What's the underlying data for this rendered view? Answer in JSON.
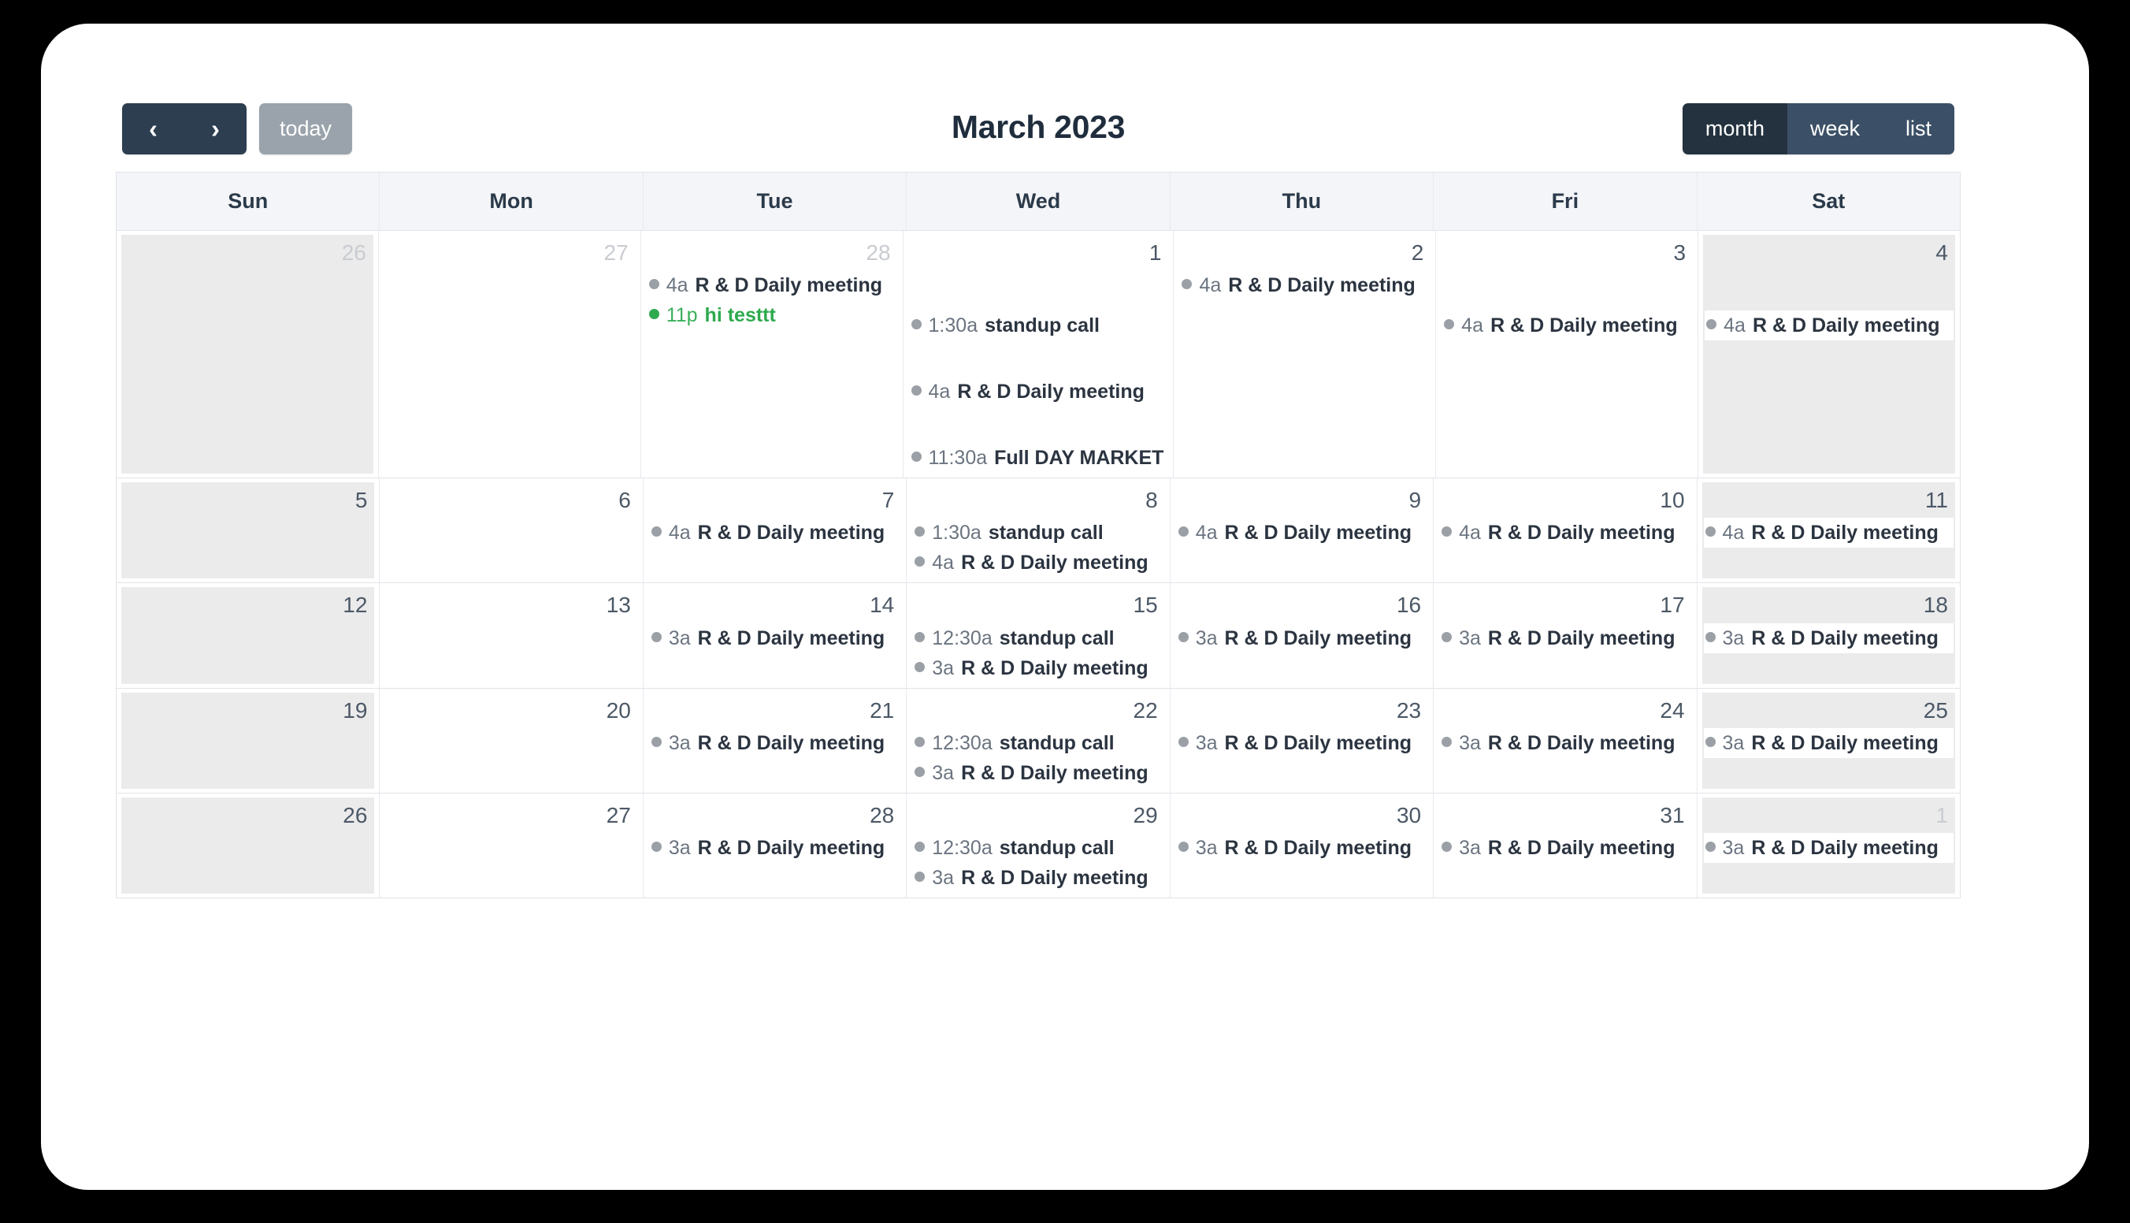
{
  "toolbar": {
    "prev_label": "‹",
    "next_label": "›",
    "today_label": "today",
    "title": "March 2023",
    "views": [
      {
        "key": "month",
        "label": "month",
        "active": true
      },
      {
        "key": "week",
        "label": "week",
        "active": false
      },
      {
        "key": "list",
        "label": "list",
        "active": false
      }
    ]
  },
  "colors": {
    "toolbar_dark": "#2c3e50",
    "today_gray": "#9aa3ab",
    "view_active": "#24323f",
    "view_inactive": "#3b5066",
    "event_dot_default": "#9aa0a6",
    "event_green": "#2eaa4e",
    "weekend_bg": "#ebebec",
    "header_bg": "#f4f5f8",
    "grid_border": "#e0e3e8"
  },
  "day_headers": [
    "Sun",
    "Mon",
    "Tue",
    "Wed",
    "Thu",
    "Fri",
    "Sat"
  ],
  "weeks": [
    {
      "days": [
        {
          "date": "26",
          "other_month": true,
          "weekend": true,
          "events": []
        },
        {
          "date": "27",
          "other_month": true,
          "weekend": false,
          "events": []
        },
        {
          "date": "28",
          "other_month": true,
          "weekend": false,
          "events": [
            {
              "time": "4a",
              "title": "R & D Daily meeting",
              "color": "default"
            },
            {
              "time": "11p",
              "title": "hi testtt",
              "color": "green"
            }
          ]
        },
        {
          "date": "1",
          "other_month": false,
          "weekend": false,
          "events": [
            {
              "time": "1:30a",
              "title": "standup call",
              "color": "default",
              "offset": 1
            },
            {
              "time": "4a",
              "title": "R & D Daily meeting",
              "color": "default",
              "offset": 1
            },
            {
              "time": "11:30a",
              "title": "Full DAY MARKET",
              "color": "default",
              "offset": 1
            }
          ]
        },
        {
          "date": "2",
          "other_month": false,
          "weekend": false,
          "events": [
            {
              "time": "4a",
              "title": "R & D Daily meeting",
              "color": "default"
            }
          ]
        },
        {
          "date": "3",
          "other_month": false,
          "weekend": false,
          "events": [
            {
              "time": "4a",
              "title": "R & D Daily meeting",
              "color": "default",
              "offset": 1
            }
          ]
        },
        {
          "date": "4",
          "other_month": false,
          "weekend": true,
          "events": [
            {
              "time": "4a",
              "title": "R & D Daily meeting",
              "color": "default",
              "offset": 1
            }
          ]
        }
      ]
    },
    {
      "days": [
        {
          "date": "5",
          "other_month": false,
          "weekend": true,
          "events": []
        },
        {
          "date": "6",
          "other_month": false,
          "weekend": false,
          "events": []
        },
        {
          "date": "7",
          "other_month": false,
          "weekend": false,
          "events": [
            {
              "time": "4a",
              "title": "R & D Daily meeting",
              "color": "default"
            }
          ]
        },
        {
          "date": "8",
          "other_month": false,
          "weekend": false,
          "events": [
            {
              "time": "1:30a",
              "title": "standup call",
              "color": "default"
            },
            {
              "time": "4a",
              "title": "R & D Daily meeting",
              "color": "default"
            }
          ]
        },
        {
          "date": "9",
          "other_month": false,
          "weekend": false,
          "events": [
            {
              "time": "4a",
              "title": "R & D Daily meeting",
              "color": "default"
            }
          ]
        },
        {
          "date": "10",
          "other_month": false,
          "weekend": false,
          "events": [
            {
              "time": "4a",
              "title": "R & D Daily meeting",
              "color": "default"
            }
          ]
        },
        {
          "date": "11",
          "other_month": false,
          "weekend": true,
          "events": [
            {
              "time": "4a",
              "title": "R & D Daily meeting",
              "color": "default"
            }
          ]
        }
      ]
    },
    {
      "days": [
        {
          "date": "12",
          "other_month": false,
          "weekend": true,
          "events": []
        },
        {
          "date": "13",
          "other_month": false,
          "weekend": false,
          "events": []
        },
        {
          "date": "14",
          "other_month": false,
          "weekend": false,
          "events": [
            {
              "time": "3a",
              "title": "R & D Daily meeting",
              "color": "default"
            }
          ]
        },
        {
          "date": "15",
          "other_month": false,
          "weekend": false,
          "events": [
            {
              "time": "12:30a",
              "title": "standup call",
              "color": "default"
            },
            {
              "time": "3a",
              "title": "R & D Daily meeting",
              "color": "default"
            }
          ]
        },
        {
          "date": "16",
          "other_month": false,
          "weekend": false,
          "events": [
            {
              "time": "3a",
              "title": "R & D Daily meeting",
              "color": "default"
            }
          ]
        },
        {
          "date": "17",
          "other_month": false,
          "weekend": false,
          "events": [
            {
              "time": "3a",
              "title": "R & D Daily meeting",
              "color": "default"
            }
          ]
        },
        {
          "date": "18",
          "other_month": false,
          "weekend": true,
          "events": [
            {
              "time": "3a",
              "title": "R & D Daily meeting",
              "color": "default"
            }
          ]
        }
      ]
    },
    {
      "days": [
        {
          "date": "19",
          "other_month": false,
          "weekend": true,
          "events": []
        },
        {
          "date": "20",
          "other_month": false,
          "weekend": false,
          "events": []
        },
        {
          "date": "21",
          "other_month": false,
          "weekend": false,
          "events": [
            {
              "time": "3a",
              "title": "R & D Daily meeting",
              "color": "default"
            }
          ]
        },
        {
          "date": "22",
          "other_month": false,
          "weekend": false,
          "events": [
            {
              "time": "12:30a",
              "title": "standup call",
              "color": "default"
            },
            {
              "time": "3a",
              "title": "R & D Daily meeting",
              "color": "default"
            }
          ]
        },
        {
          "date": "23",
          "other_month": false,
          "weekend": false,
          "events": [
            {
              "time": "3a",
              "title": "R & D Daily meeting",
              "color": "default"
            }
          ]
        },
        {
          "date": "24",
          "other_month": false,
          "weekend": false,
          "events": [
            {
              "time": "3a",
              "title": "R & D Daily meeting",
              "color": "default"
            }
          ]
        },
        {
          "date": "25",
          "other_month": false,
          "weekend": true,
          "events": [
            {
              "time": "3a",
              "title": "R & D Daily meeting",
              "color": "default"
            }
          ]
        }
      ]
    },
    {
      "days": [
        {
          "date": "26",
          "other_month": false,
          "weekend": true,
          "events": []
        },
        {
          "date": "27",
          "other_month": false,
          "weekend": false,
          "events": []
        },
        {
          "date": "28",
          "other_month": false,
          "weekend": false,
          "events": [
            {
              "time": "3a",
              "title": "R & D Daily meeting",
              "color": "default"
            }
          ]
        },
        {
          "date": "29",
          "other_month": false,
          "weekend": false,
          "events": [
            {
              "time": "12:30a",
              "title": "standup call",
              "color": "default"
            },
            {
              "time": "3a",
              "title": "R & D Daily meeting",
              "color": "default"
            }
          ]
        },
        {
          "date": "30",
          "other_month": false,
          "weekend": false,
          "events": [
            {
              "time": "3a",
              "title": "R & D Daily meeting",
              "color": "default"
            }
          ]
        },
        {
          "date": "31",
          "other_month": false,
          "weekend": false,
          "events": [
            {
              "time": "3a",
              "title": "R & D Daily meeting",
              "color": "default"
            }
          ]
        },
        {
          "date": "1",
          "other_month": true,
          "weekend": true,
          "events": [
            {
              "time": "3a",
              "title": "R & D Daily meeting",
              "color": "default"
            }
          ]
        }
      ]
    }
  ]
}
